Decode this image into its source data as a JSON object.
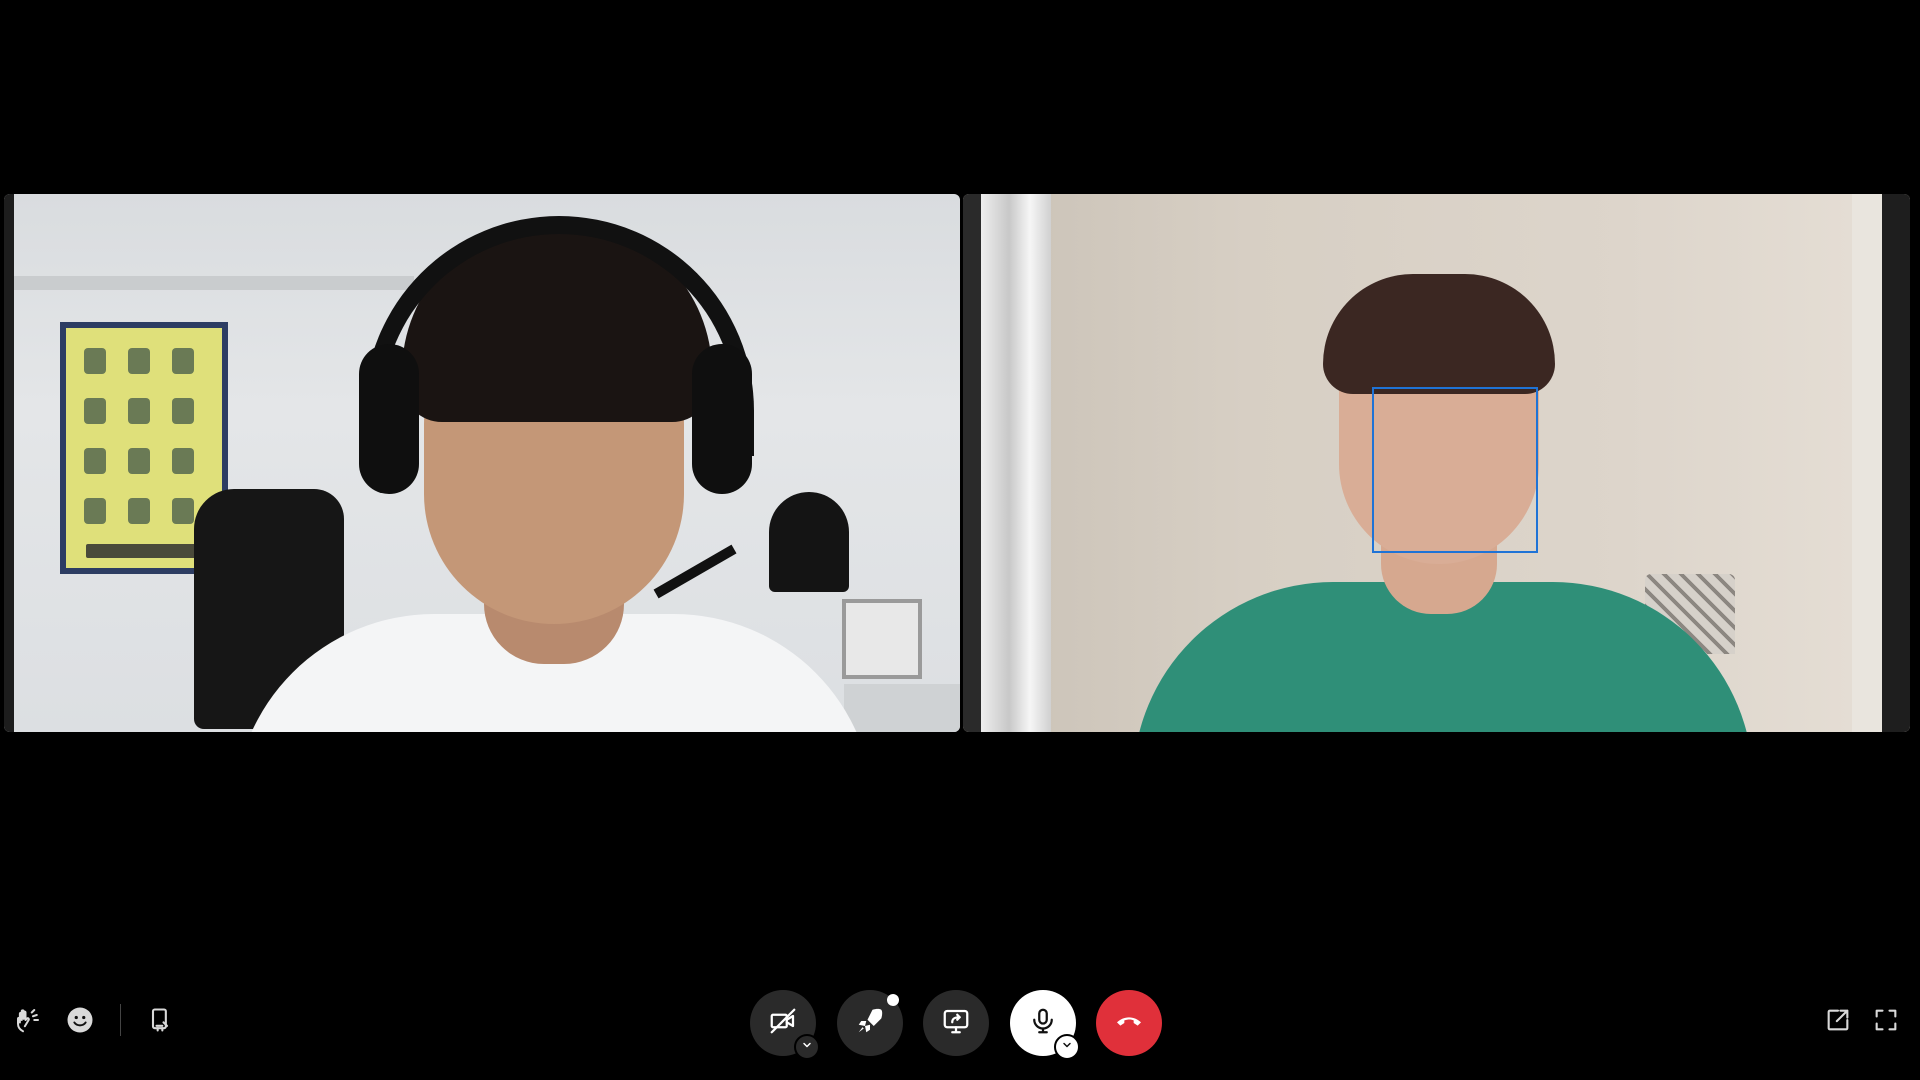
{
  "app": {
    "theme_bg": "#000000"
  },
  "participants": [
    {
      "role": "remote-participant"
    },
    {
      "role": "local-participant"
    }
  ],
  "toolbar": {
    "left": [
      {
        "icon": "raise-hand-icon"
      },
      {
        "icon": "emoji-reaction-icon"
      },
      {
        "icon": "call-info-icon"
      }
    ],
    "center": [
      {
        "icon": "camera-off-icon",
        "has_options": true,
        "color": "#2a2a2a"
      },
      {
        "icon": "effects-rocket-icon",
        "notification": true,
        "color": "#2a2a2a"
      },
      {
        "icon": "screen-share-icon",
        "color": "#2a2a2a"
      },
      {
        "icon": "microphone-icon",
        "has_options": true,
        "color": "#ffffff"
      },
      {
        "icon": "end-call-icon",
        "color": "#e0303a"
      }
    ],
    "right": [
      {
        "icon": "pop-out-icon"
      },
      {
        "icon": "fullscreen-icon"
      }
    ]
  },
  "face_detection": {
    "color": "#1f73d6"
  }
}
